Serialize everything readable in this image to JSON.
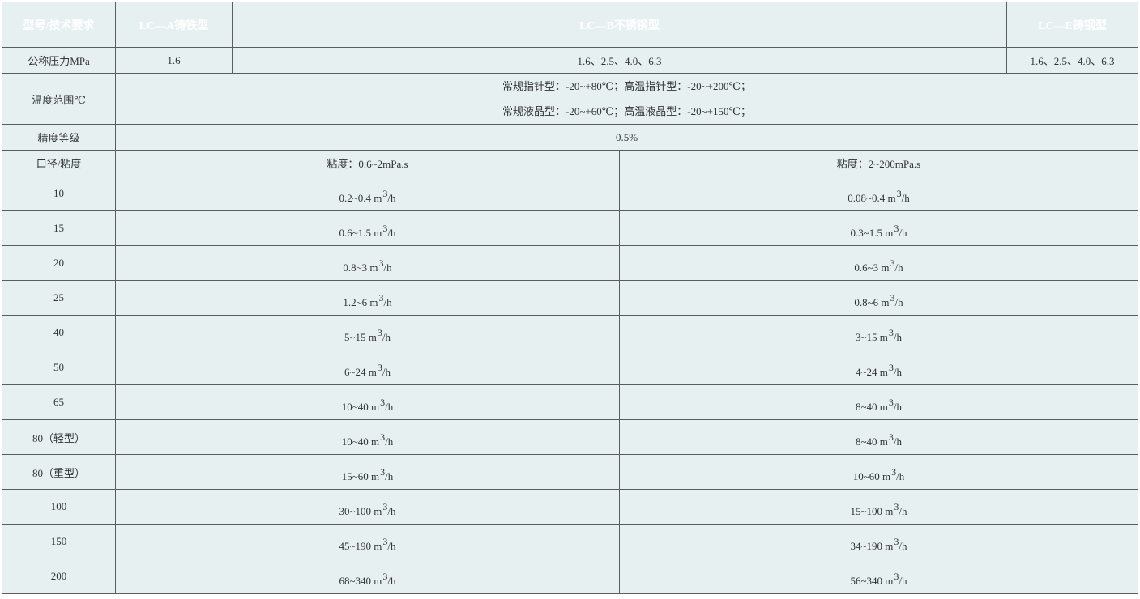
{
  "header": {
    "col_label": "型号/技术要求",
    "model_a": "LC—A铸铁型",
    "model_b": "LC—B不锈钢型",
    "model_e": "LC—E铸钢型"
  },
  "pressure": {
    "label": "公称压力MPa",
    "a": "1.6",
    "b": "1.6、2.5、4.0、6.3",
    "e": "1.6、2.5、4.0、6.3"
  },
  "temperature": {
    "label": "温度范围℃",
    "line1": "常规指针型：-20~+80℃；高温指针型：-20~+200℃；",
    "line2": "常规液晶型：-20~+60℃；高温液晶型：-20~+150℃；"
  },
  "accuracy": {
    "label": "精度等级",
    "value": "0.5%"
  },
  "viscosity": {
    "label": "口径/粘度",
    "low": "粘度：0.6~2mPa.s",
    "high": "粘度：2~200mPa.s"
  },
  "flow_rows": [
    {
      "size": "10",
      "low": "0.2~0.4 m",
      "high": "0.08~0.4 m"
    },
    {
      "size": "15",
      "low": "0.6~1.5 m",
      "high": "0.3~1.5 m"
    },
    {
      "size": "20",
      "low": "0.8~3 m",
      "high": "0.6~3 m"
    },
    {
      "size": "25",
      "low": "1.2~6 m",
      "high": "0.8~6 m"
    },
    {
      "size": "40",
      "low": "5~15 m",
      "high": "3~15 m"
    },
    {
      "size": "50",
      "low": "6~24 m",
      "high": "4~24 m"
    },
    {
      "size": "65",
      "low": "10~40 m",
      "high": "8~40 m"
    },
    {
      "size": "80（轻型）",
      "low": "10~40 m",
      "high": "8~40 m"
    },
    {
      "size": "80（重型）",
      "low": "15~60 m",
      "high": "10~60 m"
    },
    {
      "size": "100",
      "low": "30~100 m",
      "high": "15~100 m"
    },
    {
      "size": "150",
      "low": "45~190 m",
      "high": "34~190 m"
    },
    {
      "size": "200",
      "low": "68~340 m",
      "high": "56~340 m"
    }
  ],
  "unit_exponent": "3",
  "unit_suffix": "/h",
  "colors": {
    "header_bg": "#05a6c4",
    "label_bg": "#cde3e8",
    "cell_bg": "#e6f0f1",
    "border": "#5d5d5d"
  }
}
